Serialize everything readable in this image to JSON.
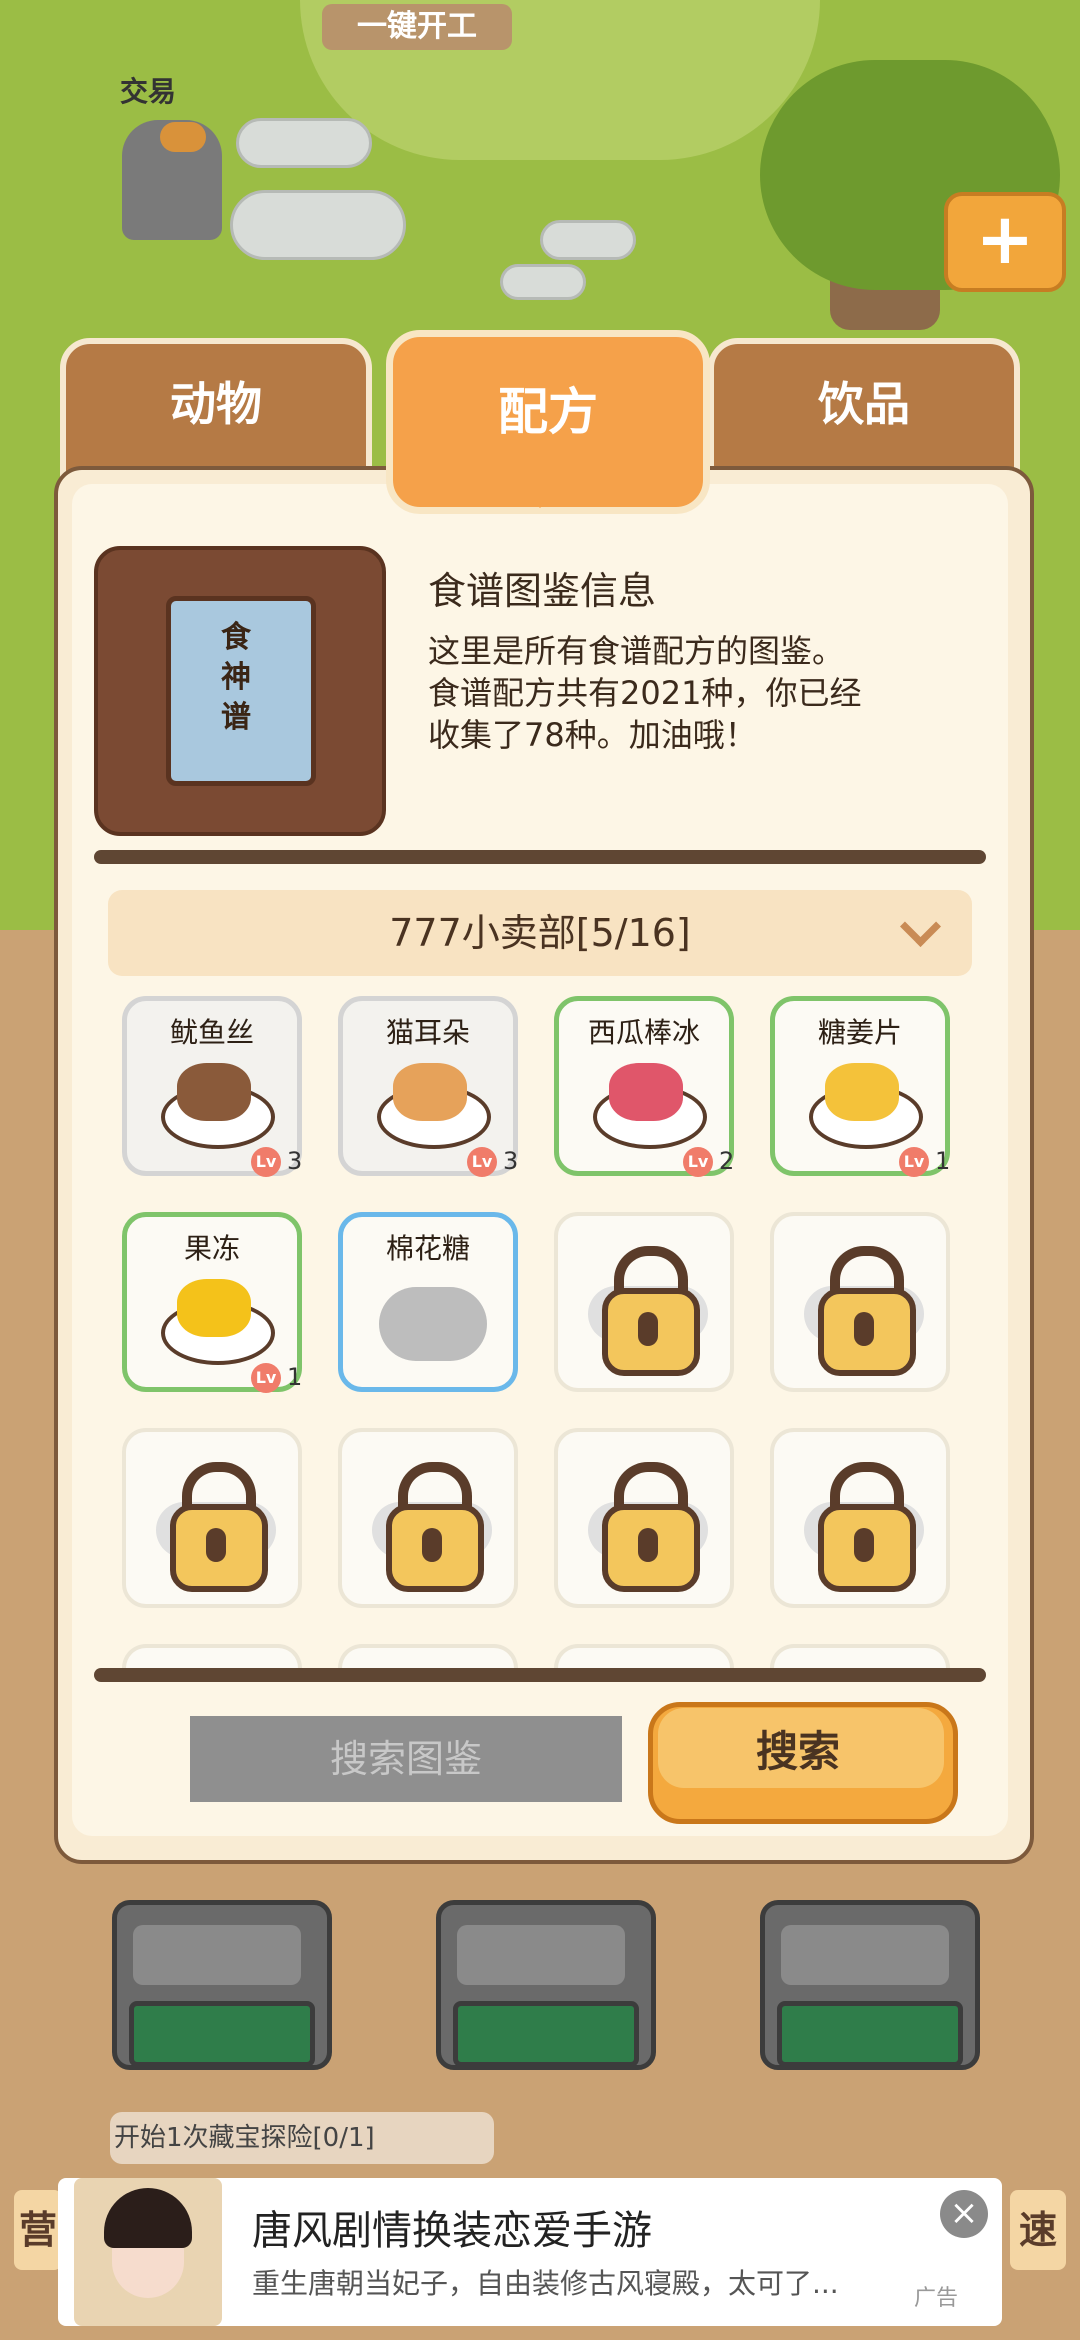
{
  "scene": {
    "top_button": "一键开工",
    "trade_label": "交易",
    "plus_button": "+"
  },
  "tabs": [
    {
      "label": "动物",
      "active": false
    },
    {
      "label": "配方",
      "active": true
    },
    {
      "label": "饮品",
      "active": false
    }
  ],
  "info": {
    "book_title": "食神谱",
    "title": "食谱图鉴信息",
    "line1": "这里是所有食谱配方的图鉴。",
    "line2": "食谱配方共有2021种，你已经",
    "line3": "收集了78种。加油哦！"
  },
  "category": {
    "label": "777小卖部[5/16]"
  },
  "recipes": [
    {
      "name": "鱿鱼丝",
      "state": "grey",
      "level": "3",
      "food_color": "#8a5a3a"
    },
    {
      "name": "猫耳朵",
      "state": "grey",
      "level": "3",
      "food_color": "#e6a25a"
    },
    {
      "name": "西瓜棒冰",
      "state": "green",
      "level": "2",
      "food_color": "#e0566a"
    },
    {
      "name": "糖姜片",
      "state": "green",
      "level": "1",
      "food_color": "#f4c23a"
    },
    {
      "name": "果冻",
      "state": "green",
      "level": "1",
      "food_color": "#f4c21a"
    },
    {
      "name": "棉花糖",
      "state": "blue",
      "level": "",
      "food_color": "#bdbdbd"
    }
  ],
  "level_badge": "Lv",
  "buttons": {
    "search_field": "搜索图鉴",
    "search": "搜索"
  },
  "quest": "开始1次藏宝探险[0/1]",
  "side_left": "营",
  "side_right": "速",
  "ad": {
    "title": "唐风剧情换装恋爱手游",
    "desc": "重生唐朝当妃子，自由装修古风寝殿，太可了...",
    "label": "广告",
    "close": "×"
  }
}
